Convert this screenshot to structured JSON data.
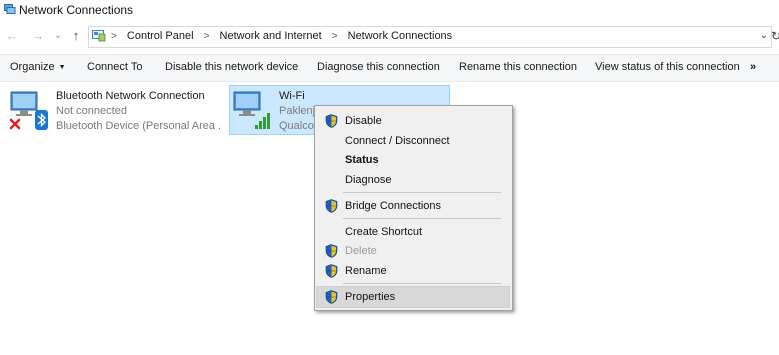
{
  "window": {
    "title": "Network Connections"
  },
  "nav": {
    "back": "←",
    "forward": "→",
    "history": "⌄",
    "up": "↑",
    "refresh": "↻",
    "dropdown": "⌄"
  },
  "breadcrumb": {
    "items": [
      "Control Panel",
      "Network and Internet",
      "Network Connections"
    ],
    "separator": ">"
  },
  "toolbar": {
    "organize": "Organize",
    "connect_to": "Connect To",
    "disable_device": "Disable this network device",
    "diagnose": "Diagnose this connection",
    "rename": "Rename this connection",
    "view_status": "View status of this connection",
    "more": "»"
  },
  "connections": [
    {
      "name": "Bluetooth Network Connection",
      "status": "Not connected",
      "device": "Bluetooth Device (Personal Area ...",
      "icon": "bluetooth-network-icon"
    },
    {
      "name": "Wi-Fi",
      "status": "Paklenja",
      "device": "Qualcom",
      "icon": "wifi-network-icon"
    }
  ],
  "context_menu": {
    "items": [
      {
        "label": "Disable",
        "shield": true
      },
      {
        "label": "Connect / Disconnect",
        "shield": false
      },
      {
        "label": "Status",
        "shield": false,
        "bold": true
      },
      {
        "label": "Diagnose",
        "shield": false
      },
      {
        "label": "Bridge Connections",
        "shield": true
      },
      {
        "label": "Create Shortcut",
        "shield": false
      },
      {
        "label": "Delete",
        "shield": true,
        "disabled": true
      },
      {
        "label": "Rename",
        "shield": true
      },
      {
        "label": "Properties",
        "shield": true,
        "highlighted": true
      }
    ]
  },
  "colors": {
    "selection": "#cce8ff",
    "selection_border": "#99d1ff",
    "menu_bg": "#f0f0f0",
    "menu_hover": "#d8d8d8"
  }
}
